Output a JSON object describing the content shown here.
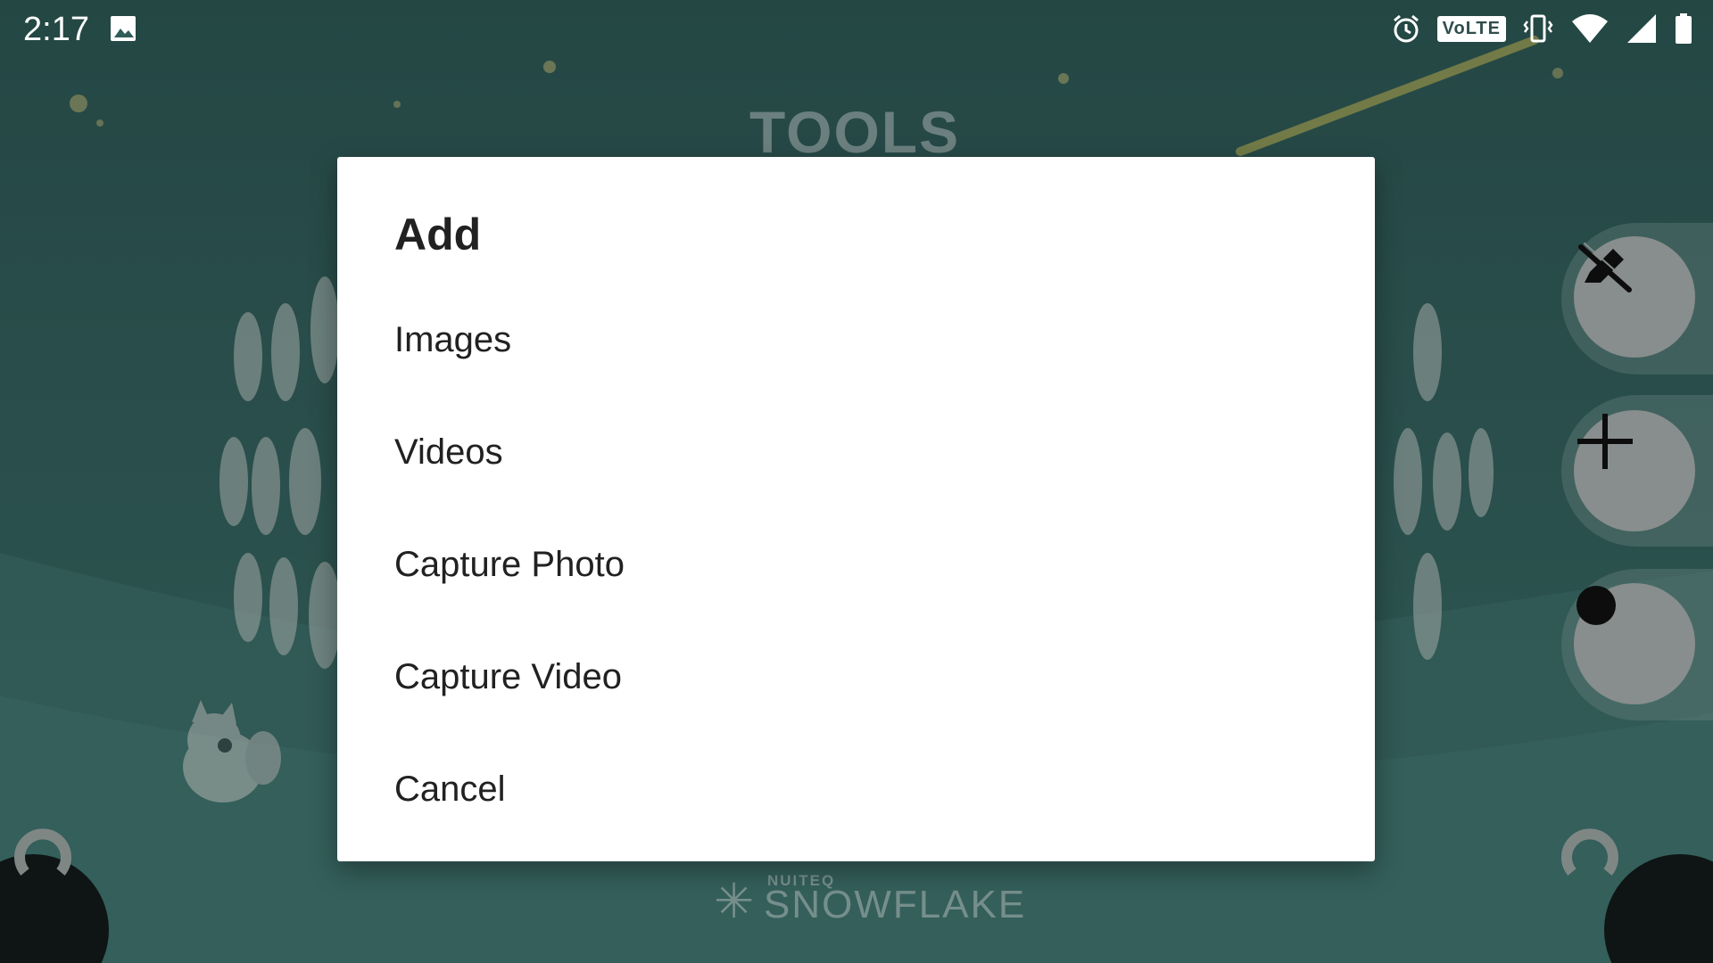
{
  "status_bar": {
    "time": "2:17",
    "network_badge": "VoLTE",
    "icons": [
      "image-icon",
      "alarm-icon",
      "vibrate-icon",
      "wifi-icon",
      "cell-signal-icon",
      "battery-icon"
    ]
  },
  "background": {
    "heading": "TOOLS",
    "brand_small": "NUITEQ",
    "brand_name": "SNOWFLAKE"
  },
  "side_buttons": [
    {
      "icon": "edit-disabled-icon"
    },
    {
      "icon": "plus-icon"
    },
    {
      "icon": "record-dot-icon"
    }
  ],
  "corner_buttons": [
    {
      "icon": "rotate-left-icon"
    },
    {
      "icon": "rotate-right-icon"
    }
  ],
  "dialog": {
    "title": "Add",
    "items": [
      {
        "label": "Images"
      },
      {
        "label": "Videos"
      },
      {
        "label": "Capture Photo"
      },
      {
        "label": "Capture Video"
      },
      {
        "label": "Cancel"
      }
    ]
  },
  "colors": {
    "background": "#2f5c59",
    "dialog": "#ffffff",
    "text": "#212121",
    "side_button": "#a6aeac"
  }
}
